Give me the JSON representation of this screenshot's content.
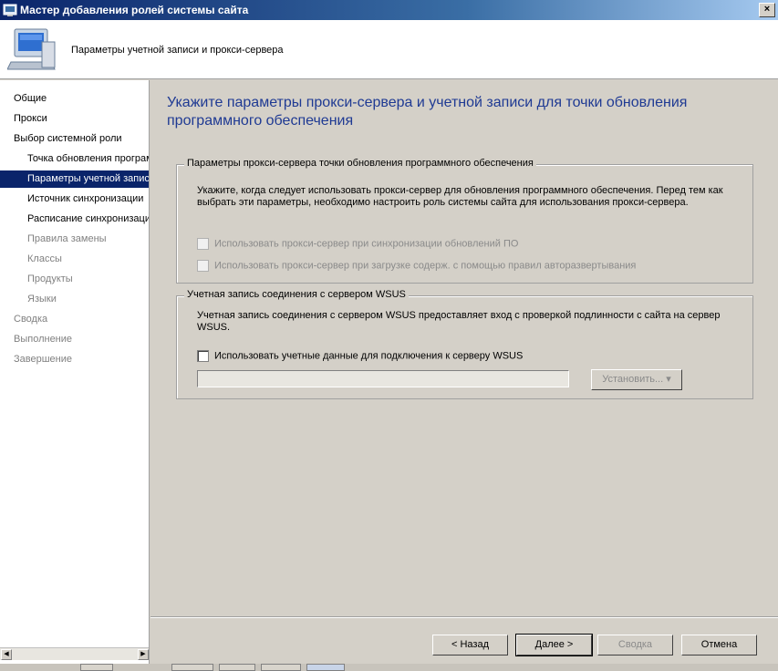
{
  "window": {
    "title": "Мастер добавления ролей системы сайта",
    "close_glyph": "×",
    "app_icon": "wizard-icon"
  },
  "header": {
    "subtitle": "Параметры учетной записи и прокси-сервера",
    "icon": "computer-icon"
  },
  "nav": {
    "items": [
      {
        "label": "Общие"
      },
      {
        "label": "Прокси"
      },
      {
        "label": "Выбор системной роли"
      },
      {
        "label": "Точка обновления программного обеспечения"
      },
      {
        "label": "Параметры учетной записи"
      },
      {
        "label": "Источник синхронизации"
      },
      {
        "label": "Расписание синхронизации"
      },
      {
        "label": "Правила замены"
      },
      {
        "label": "Классы"
      },
      {
        "label": "Продукты"
      },
      {
        "label": "Языки"
      },
      {
        "label": "Сводка"
      },
      {
        "label": "Выполнение"
      },
      {
        "label": "Завершение"
      }
    ]
  },
  "main": {
    "title": "Укажите параметры прокси-сервера и учетной записи для точки обновления программного обеспечения",
    "proxy_group": {
      "legend": "Параметры прокси-сервера точки обновления программного обеспечения",
      "description": "Укажите, когда следует использовать прокси-сервер для обновления программного обеспечения. Перед тем как выбрать эти параметры, необходимо настроить роль системы сайта для использования прокси-сервера.",
      "option1": "Использовать прокси-сервер при синхронизации обновлений ПО",
      "option2": "Использовать прокси-сервер при загрузке содерж. с помощью правил авторазвертывания"
    },
    "wsus_group": {
      "legend": "Учетная запись соединения с сервером WSUS",
      "description": "Учетная запись соединения с сервером WSUS предоставляет вход с проверкой подлинности с сайта на сервер WSUS.",
      "option": "Использовать учетные данные для подключения к серверу WSUS",
      "account_value": "",
      "set_button": "Установить... ▾"
    }
  },
  "footer": {
    "back": "< Назад",
    "next": "Далее >",
    "summary": "Сводка",
    "cancel": "Отмена"
  }
}
